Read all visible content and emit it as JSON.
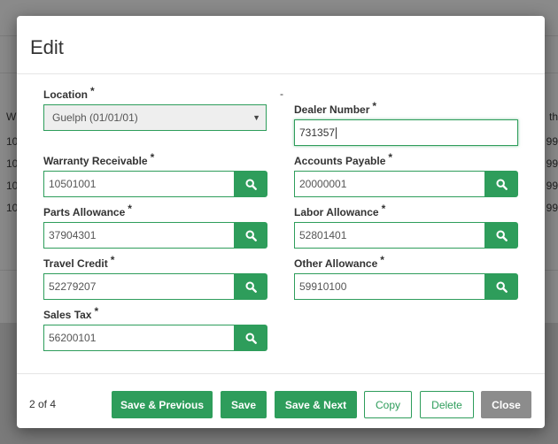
{
  "background": {
    "left_rows": [
      "W",
      "10",
      "10",
      "10",
      "10"
    ],
    "right_rows": [
      "th",
      "99",
      "99",
      "99",
      "99"
    ]
  },
  "modal": {
    "title": "Edit",
    "dash": "-",
    "fields": {
      "location": {
        "label": "Location",
        "required": "*",
        "value": "Guelph (01/01/01)"
      },
      "dealer_number": {
        "label": "Dealer Number",
        "required": "*",
        "value": "731357"
      },
      "warranty_receivable": {
        "label": "Warranty Receivable",
        "required": "*",
        "value": "10501001"
      },
      "accounts_payable": {
        "label": "Accounts Payable",
        "required": "*",
        "value": "20000001"
      },
      "parts_allowance": {
        "label": "Parts Allowance",
        "required": "*",
        "value": "37904301"
      },
      "labor_allowance": {
        "label": "Labor Allowance",
        "required": "*",
        "value": "52801401"
      },
      "travel_credit": {
        "label": "Travel Credit",
        "required": "*",
        "value": "52279207"
      },
      "other_allowance": {
        "label": "Other Allowance",
        "required": "*",
        "value": "59910100"
      },
      "sales_tax": {
        "label": "Sales Tax",
        "required": "*",
        "value": "56200101"
      }
    },
    "footer": {
      "page_counter": "2 of 4",
      "save_previous": "Save & Previous",
      "save": "Save",
      "save_next": "Save & Next",
      "copy": "Copy",
      "delete": "Delete",
      "close": "Close"
    }
  },
  "colors": {
    "accent": "#2e9d5b",
    "close_button": "#8c8c8c"
  },
  "icons": {
    "search": "search-icon",
    "select_caret": "caret-down-icon"
  }
}
